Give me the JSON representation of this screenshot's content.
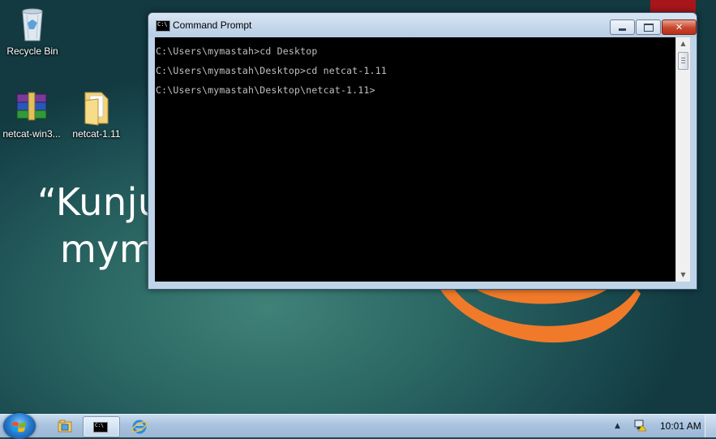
{
  "desktop": {
    "wallpaper_text": [
      "“Kunju",
      "mym"
    ],
    "icons": [
      {
        "label": "Recycle Bin",
        "icon": "recycle-bin-icon"
      },
      {
        "label": "netcat-win3...",
        "icon": "winrar-archive-icon"
      },
      {
        "label": "netcat-1.11",
        "icon": "folder-icon"
      }
    ]
  },
  "window": {
    "title": "Command Prompt",
    "buttons": {
      "minimize": "minimize",
      "maximize": "maximize",
      "close": "close"
    },
    "console_lines": [
      "C:\\Users\\mymastah>cd Desktop",
      "C:\\Users\\mymastah\\Desktop>cd netcat-1.11",
      "C:\\Users\\mymastah\\Desktop\\netcat-1.11>"
    ],
    "icon_text": "C:\\"
  },
  "taskbar": {
    "start": "start-orb-icon",
    "pinned": [
      {
        "name": "windows-explorer",
        "icon": "folder-library-icon"
      },
      {
        "name": "command-prompt",
        "icon": "cmd-icon",
        "active": true
      },
      {
        "name": "internet-explorer",
        "icon": "ie-icon"
      }
    ],
    "tray": {
      "show_hidden": "▲",
      "time": "10:01 AM"
    }
  },
  "colors": {
    "console_bg": "#000000",
    "console_text": "#c0c0c0",
    "accent_orange": "#f07a2a",
    "accent_red": "#a8161b"
  }
}
